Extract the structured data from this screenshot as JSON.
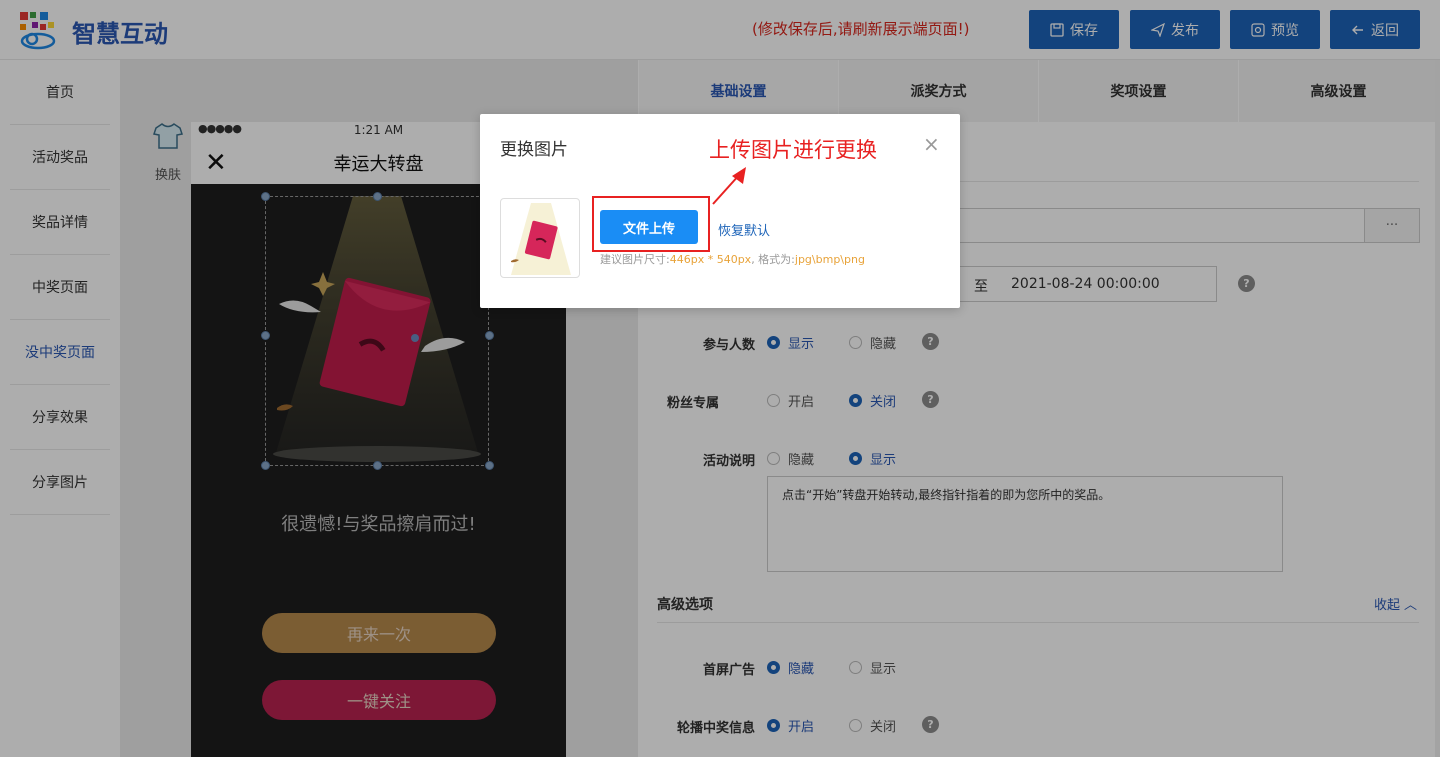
{
  "header": {
    "brand": "智慧互动",
    "notice": "(修改保存后,请刷新展示端页面!)",
    "buttons": {
      "save": "保存",
      "publish": "发布",
      "preview": "预览",
      "back": "返回"
    }
  },
  "sidebar": {
    "items": [
      {
        "label": "首页"
      },
      {
        "label": "活动奖品"
      },
      {
        "label": "奖品详情"
      },
      {
        "label": "中奖页面"
      },
      {
        "label": "没中奖页面"
      },
      {
        "label": "分享效果"
      },
      {
        "label": "分享图片"
      }
    ],
    "active_index": 4
  },
  "skin": {
    "label": "换肤"
  },
  "phone": {
    "signal": "●●●●●",
    "time": "1:21 AM",
    "title": "幸运大转盘",
    "close": "✕",
    "sorry_text": "很遗憾!与奖品擦肩而过!",
    "retry_button": "再来一次",
    "follow_button": "一键关注"
  },
  "right": {
    "tabs": [
      "基础设置",
      "派奖方式",
      "奖项设置",
      "高级设置"
    ],
    "active_tab": 0,
    "date_separator": "至",
    "end_date": "2021-08-24 00:00:00",
    "more_button": "···",
    "rows": {
      "participants": {
        "label": "参与人数",
        "opt1": "显示",
        "opt2": "隐藏"
      },
      "fans_only": {
        "label": "粉丝专属",
        "opt1": "开启",
        "opt2": "关闭"
      },
      "description": {
        "label": "活动说明",
        "opt1": "隐藏",
        "opt2": "显示"
      },
      "description_text": "点击“开始”转盘开始转动,最终指针指着的即为您所中的奖品。",
      "splash_ad": {
        "label": "首屏广告",
        "opt1": "隐藏",
        "opt2": "显示"
      },
      "carousel": {
        "label": "轮播中奖信息",
        "opt1": "开启",
        "opt2": "关闭"
      }
    },
    "advanced_title": "高级选项",
    "collapse": "收起",
    "help_mark": "?"
  },
  "modal": {
    "title": "更换图片",
    "close": "×",
    "upload_button": "文件上传",
    "restore_default": "恢复默认",
    "hint_prefix": "建议图片尺寸:",
    "hint_size": "446px * 540px",
    "hint_mid": ", 格式为:",
    "hint_formats": "jpg\\bmp\\png",
    "annotation": "上传图片进行更换"
  },
  "colors": {
    "primary": "#1c63b8",
    "brand_text": "#2a57b3",
    "notice_red": "#d9261c",
    "annotation_red": "#e82121",
    "upload_blue": "#1a8df5",
    "hint_orange": "#e8a33a"
  }
}
